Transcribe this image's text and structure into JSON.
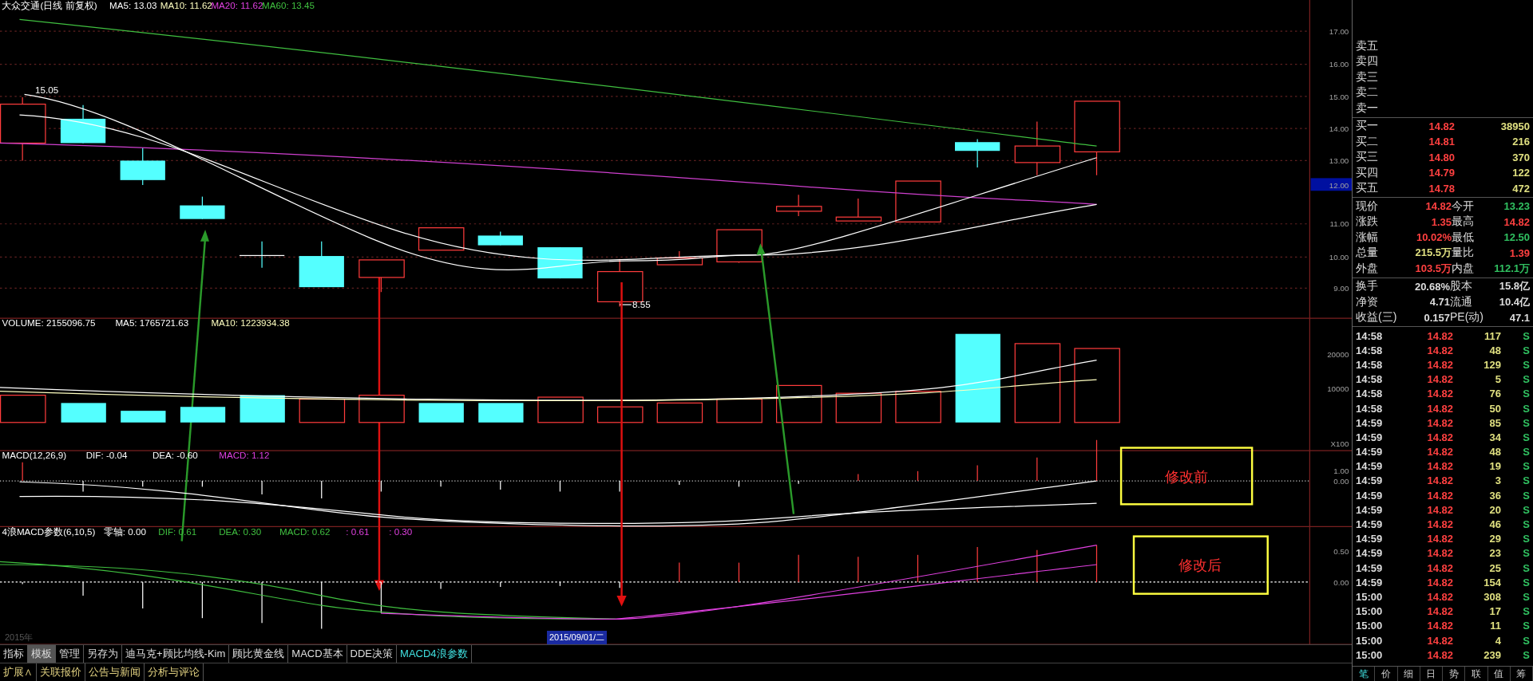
{
  "chart": {
    "title": "大众交通(日线 前复权)",
    "ma_labels": [
      {
        "text": "MA5: 13.03",
        "color": "#ffffff"
      },
      {
        "text": "MA10: 11.62",
        "color": "#ffffc0"
      },
      {
        "text": "MA20: 11.62",
        "color": "#e040e0"
      },
      {
        "text": "MA60: 13.45",
        "color": "#40c040"
      }
    ],
    "price_axis": [
      "17.00",
      "16.00",
      "15.00",
      "14.00",
      "13.00",
      "11.00",
      "10.00",
      "9.00"
    ],
    "crosshair_price": "12.00",
    "high_label": "15.05",
    "low_label": "8.55"
  },
  "volume": {
    "labels": [
      {
        "text": "VOLUME: 2155096.75",
        "color": "#ffffff"
      },
      {
        "text": "MA5: 1765721.63",
        "color": "#ffffff"
      },
      {
        "text": "MA10: 1223934.38",
        "color": "#ffffc0"
      }
    ],
    "axis": [
      "20000",
      "10000"
    ],
    "unit": "X100"
  },
  "macd": {
    "labels": [
      {
        "text": "MACD(12,26,9)",
        "color": "#ffffff"
      },
      {
        "text": "DIF: -0.04",
        "color": "#ffffff"
      },
      {
        "text": "DEA: -0.60",
        "color": "#ffffff"
      },
      {
        "text": "MACD: 1.12",
        "color": "#e040e0"
      }
    ],
    "axis": [
      "1.00",
      "0.00"
    ],
    "note": "修改前"
  },
  "wave_macd": {
    "labels": [
      {
        "text": "4浪MACD参数(6,10,5)",
        "color": "#ffffff"
      },
      {
        "text": "零轴: 0.00",
        "color": "#ffffff"
      },
      {
        "text": "DIF: 0.61",
        "color": "#40c040"
      },
      {
        "text": "DEA: 0.30",
        "color": "#40c040"
      },
      {
        "text": "MACD: 0.62",
        "color": "#40c040"
      },
      {
        "text": ": 0.61",
        "color": "#e040e0"
      },
      {
        "text": ": 0.30",
        "color": "#e040e0"
      }
    ],
    "axis": [
      "0.50",
      "0.00"
    ],
    "note": "修改后"
  },
  "date_strip": {
    "year": "2015年",
    "crosshair_date": "2015/09/01/二"
  },
  "tabs": [
    {
      "label": "指标",
      "pressed": false,
      "selected": false
    },
    {
      "label": "模板",
      "pressed": true,
      "selected": false
    },
    {
      "label": "管理",
      "pressed": false,
      "selected": false
    },
    {
      "label": "另存为",
      "pressed": false,
      "selected": false
    },
    {
      "label": "迪马克+顾比均线-Kim",
      "pressed": false,
      "selected": false
    },
    {
      "label": "顾比黄金线",
      "pressed": false,
      "selected": false
    },
    {
      "label": "MACD基本",
      "pressed": false,
      "selected": false
    },
    {
      "label": "DDE决策",
      "pressed": false,
      "selected": false
    },
    {
      "label": "MACD4浪参数",
      "pressed": false,
      "selected": true
    }
  ],
  "bottom_tabs": [
    "扩展∧",
    "关联报价",
    "公告与新闻",
    "分析与评论"
  ],
  "quote": {
    "sell": [
      "卖五",
      "卖四",
      "卖三",
      "卖二",
      "卖一"
    ],
    "buy": [
      {
        "label": "买一",
        "price": "14.82",
        "volume": "38950"
      },
      {
        "label": "买二",
        "price": "14.81",
        "volume": "216"
      },
      {
        "label": "买三",
        "price": "14.80",
        "volume": "370"
      },
      {
        "label": "买四",
        "price": "14.79",
        "volume": "122"
      },
      {
        "label": "买五",
        "price": "14.78",
        "volume": "472"
      }
    ],
    "stats": [
      {
        "label": "现价",
        "value": "14.82",
        "color": "#ff4040"
      },
      {
        "label": "今开",
        "value": "13.23",
        "color": "#30c060"
      },
      {
        "label": "涨跌",
        "value": "1.35",
        "color": "#ff4040"
      },
      {
        "label": "最高",
        "value": "14.82",
        "color": "#ff4040"
      },
      {
        "label": "涨幅",
        "value": "10.02%",
        "color": "#ff4040"
      },
      {
        "label": "最低",
        "value": "12.50",
        "color": "#30c060"
      },
      {
        "label": "总量",
        "value": "215.5万",
        "color": "#e0e080"
      },
      {
        "label": "量比",
        "value": "1.39",
        "color": "#ff4040"
      },
      {
        "label": "外盘",
        "value": "103.5万",
        "color": "#ff4040"
      },
      {
        "label": "内盘",
        "value": "112.1万",
        "color": "#30c060"
      }
    ],
    "finance": [
      {
        "label": "换手",
        "value": "20.68%"
      },
      {
        "label": "股本",
        "value": "15.8亿"
      },
      {
        "label": "净资",
        "value": "4.71"
      },
      {
        "label": "流通",
        "value": "10.4亿"
      },
      {
        "label": "收益(三)",
        "value": "0.157"
      },
      {
        "label": "PE(动)",
        "value": "47.1"
      }
    ]
  },
  "trades": [
    {
      "time": "14:58",
      "price": "14.82",
      "volume": "117",
      "side": "S"
    },
    {
      "time": "14:58",
      "price": "14.82",
      "volume": "48",
      "side": "S"
    },
    {
      "time": "14:58",
      "price": "14.82",
      "volume": "129",
      "side": "S"
    },
    {
      "time": "14:58",
      "price": "14.82",
      "volume": "5",
      "side": "S"
    },
    {
      "time": "14:58",
      "price": "14.82",
      "volume": "76",
      "side": "S"
    },
    {
      "time": "14:58",
      "price": "14.82",
      "volume": "50",
      "side": "S"
    },
    {
      "time": "14:59",
      "price": "14.82",
      "volume": "85",
      "side": "S"
    },
    {
      "time": "14:59",
      "price": "14.82",
      "volume": "34",
      "side": "S"
    },
    {
      "time": "14:59",
      "price": "14.82",
      "volume": "48",
      "side": "S"
    },
    {
      "time": "14:59",
      "price": "14.82",
      "volume": "19",
      "side": "S"
    },
    {
      "time": "14:59",
      "price": "14.82",
      "volume": "3",
      "side": "S"
    },
    {
      "time": "14:59",
      "price": "14.82",
      "volume": "36",
      "side": "S"
    },
    {
      "time": "14:59",
      "price": "14.82",
      "volume": "20",
      "side": "S"
    },
    {
      "time": "14:59",
      "price": "14.82",
      "volume": "46",
      "side": "S"
    },
    {
      "time": "14:59",
      "price": "14.82",
      "volume": "29",
      "side": "S"
    },
    {
      "time": "14:59",
      "price": "14.82",
      "volume": "23",
      "side": "S"
    },
    {
      "time": "14:59",
      "price": "14.82",
      "volume": "25",
      "side": "S"
    },
    {
      "time": "14:59",
      "price": "14.82",
      "volume": "154",
      "side": "S"
    },
    {
      "time": "15:00",
      "price": "14.82",
      "volume": "308",
      "side": "S"
    },
    {
      "time": "15:00",
      "price": "14.82",
      "volume": "17",
      "side": "S"
    },
    {
      "time": "15:00",
      "price": "14.82",
      "volume": "11",
      "side": "S"
    },
    {
      "time": "15:00",
      "price": "14.82",
      "volume": "4",
      "side": "S"
    },
    {
      "time": "15:00",
      "price": "14.82",
      "volume": "239",
      "side": "S"
    }
  ],
  "detail_tabs": [
    {
      "label": "笔",
      "selected": true
    },
    {
      "label": "价",
      "selected": false
    },
    {
      "label": "细",
      "selected": false
    },
    {
      "label": "日",
      "selected": false
    },
    {
      "label": "势",
      "selected": false
    },
    {
      "label": "联",
      "selected": false
    },
    {
      "label": "值",
      "selected": false
    },
    {
      "label": "筹",
      "selected": false
    }
  ]
}
